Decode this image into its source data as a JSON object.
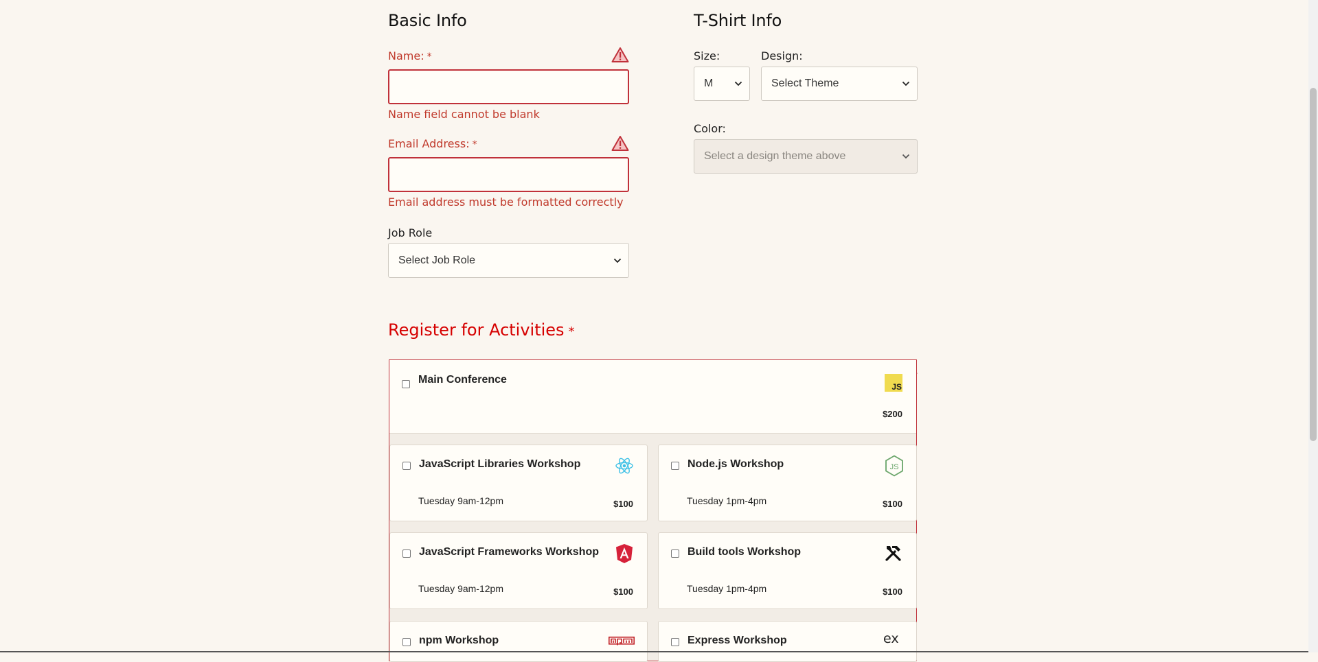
{
  "basic_info": {
    "title": "Basic Info",
    "name": {
      "label": "Name:",
      "required_mark": "*",
      "value": "",
      "error": "Name field cannot be blank"
    },
    "email": {
      "label": "Email Address:",
      "required_mark": "*",
      "value": "",
      "error": "Email address must be formatted correctly"
    },
    "job_role": {
      "label": "Job Role",
      "selected": "Select Job Role"
    }
  },
  "tshirt_info": {
    "title": "T-Shirt Info",
    "size": {
      "label": "Size:",
      "selected": "M"
    },
    "design": {
      "label": "Design:",
      "selected": "Select Theme"
    },
    "color": {
      "label": "Color:",
      "selected": "Select a design theme above"
    }
  },
  "activities": {
    "title": "Register for Activities",
    "required_mark": "*",
    "items": [
      {
        "name": "Main Conference",
        "time": "",
        "cost": "$200",
        "icon": "javascript-icon"
      },
      {
        "name": "JavaScript Libraries Workshop",
        "time": "Tuesday 9am-12pm",
        "cost": "$100",
        "icon": "react-icon"
      },
      {
        "name": "Node.js Workshop",
        "time": "Tuesday 1pm-4pm",
        "cost": "$100",
        "icon": "nodejs-icon"
      },
      {
        "name": "JavaScript Frameworks Workshop",
        "time": "Tuesday 9am-12pm",
        "cost": "$100",
        "icon": "angular-icon"
      },
      {
        "name": "Build tools Workshop",
        "time": "Tuesday 1pm-4pm",
        "cost": "$100",
        "icon": "build-tools-icon"
      },
      {
        "name": "npm Workshop",
        "time": "",
        "cost": "",
        "icon": "npm-icon"
      },
      {
        "name": "Express Workshop",
        "time": "",
        "cost": "",
        "icon": "express-icon"
      }
    ]
  },
  "colors": {
    "error": "#c0392b",
    "heading_error": "#d60000",
    "background": "#faf6f0",
    "js_yellow": "#f0db4f"
  }
}
